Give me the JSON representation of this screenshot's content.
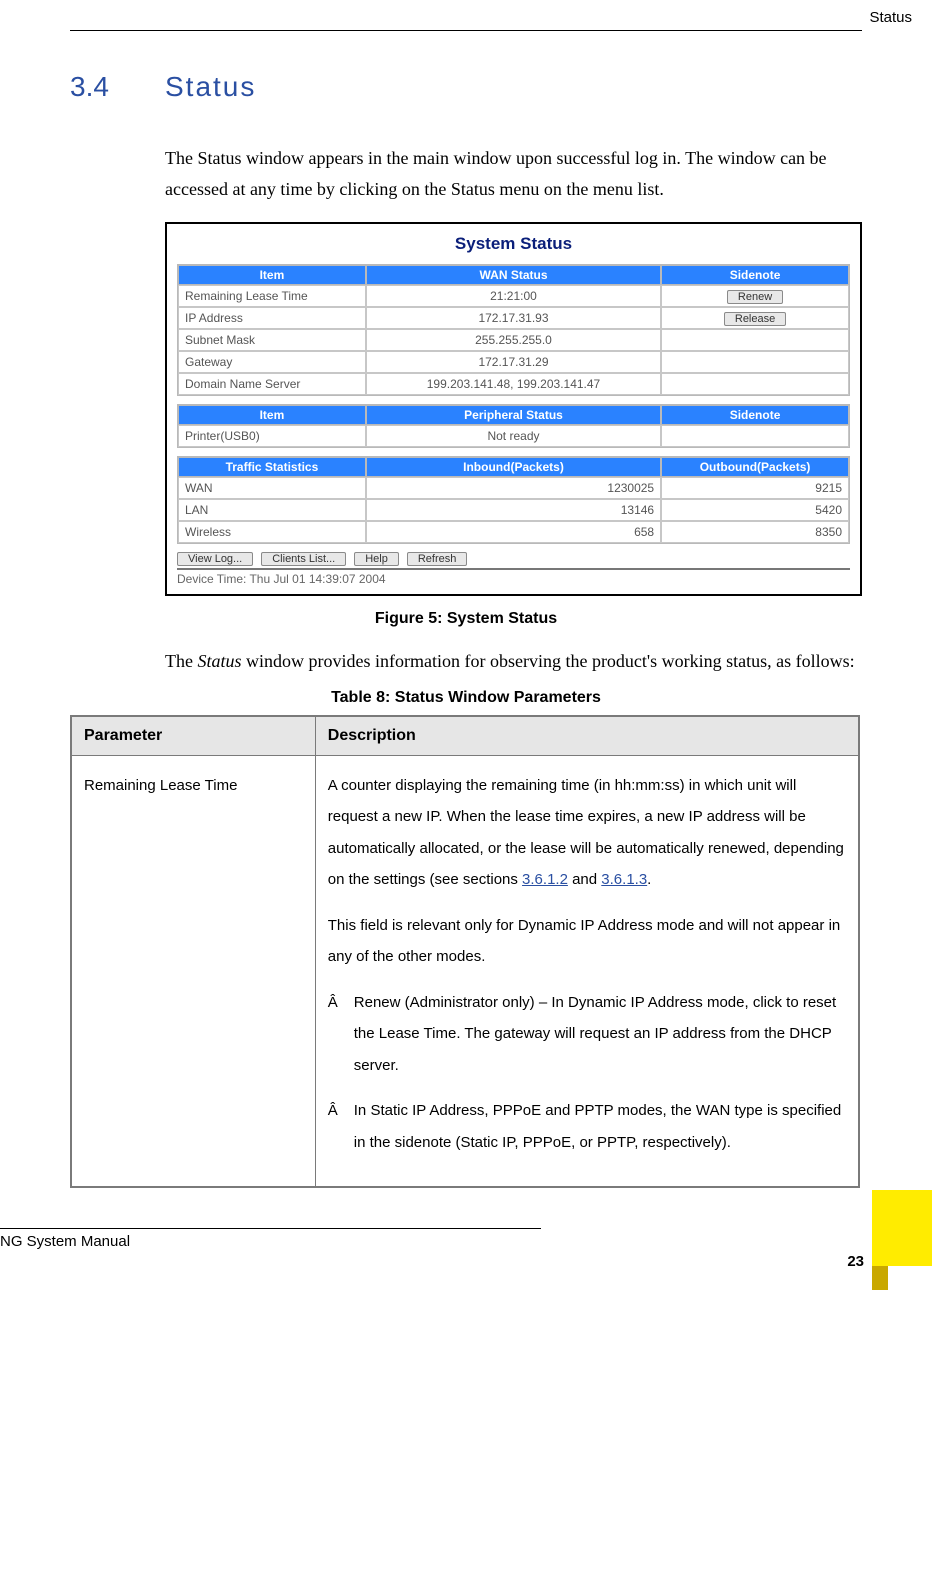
{
  "header": {
    "label": "Status"
  },
  "section": {
    "number": "3.4",
    "title": "Status"
  },
  "intro": "The Status window appears in the main window upon successful log in. The window can be accessed at any time by clicking on the Status menu on the menu list.",
  "screenshot": {
    "title": "System Status",
    "wan_table": {
      "headers": [
        "Item",
        "WAN Status",
        "Sidenote"
      ],
      "rows": [
        {
          "item": "Remaining Lease Time",
          "value": "21:21:00",
          "note_btn": "Renew"
        },
        {
          "item": "IP Address",
          "value": "172.17.31.93",
          "note_btn": "Release"
        },
        {
          "item": "Subnet Mask",
          "value": "255.255.255.0",
          "note_btn": ""
        },
        {
          "item": "Gateway",
          "value": "172.17.31.29",
          "note_btn": ""
        },
        {
          "item": "Domain Name Server",
          "value": "199.203.141.48, 199.203.141.47",
          "note_btn": ""
        }
      ]
    },
    "periph_table": {
      "headers": [
        "Item",
        "Peripheral Status",
        "Sidenote"
      ],
      "rows": [
        {
          "item": "Printer(USB0)",
          "value": "Not ready",
          "note": ""
        }
      ]
    },
    "traffic_table": {
      "headers": [
        "Traffic Statistics",
        "Inbound(Packets)",
        "Outbound(Packets)"
      ],
      "rows": [
        {
          "item": "WAN",
          "in": "1230025",
          "out": "9215"
        },
        {
          "item": "LAN",
          "in": "13146",
          "out": "5420"
        },
        {
          "item": "Wireless",
          "in": "658",
          "out": "8350"
        }
      ]
    },
    "buttons": [
      "View Log...",
      "Clients List...",
      "Help",
      "Refresh"
    ],
    "device_time": "Device Time: Thu Jul 01 14:39:07 2004"
  },
  "figure_caption": "Figure 5: System Status",
  "after_fig_pre": "The ",
  "after_fig_em": "Status",
  "after_fig_post": " window provides information for observing the product's working status, as follows:",
  "table_caption": "Table 8: Status Window Parameters",
  "param_table": {
    "headers": [
      "Parameter",
      "Description"
    ],
    "row": {
      "param": "Remaining Lease Time",
      "p1_a": "A counter displaying the remaining time (in hh:mm:ss) in which unit will request a new IP. When the lease time expires, a new IP address will be automatically allocated, or the lease will be automatically renewed, depending on the settings (see sections ",
      "link1": "3.6.1.2",
      "p1_mid": " and ",
      "link2": "3.6.1.3",
      "p1_end": ".",
      "p2": "This field is relevant only for Dynamic IP Address mode and will not appear in any of the other modes.",
      "bullet_sym": "Â",
      "b1": "Renew (Administrator only) – In Dynamic IP Address mode, click to reset the Lease Time. The gateway will request an IP address from the DHCP server.",
      "b2": "In Static IP Address, PPPoE and PPTP modes, the WAN type is specified in the sidenote (Static IP, PPPoE, or PPTP, respectively)."
    }
  },
  "footer": {
    "manual": "NG System Manual",
    "page": "23"
  }
}
